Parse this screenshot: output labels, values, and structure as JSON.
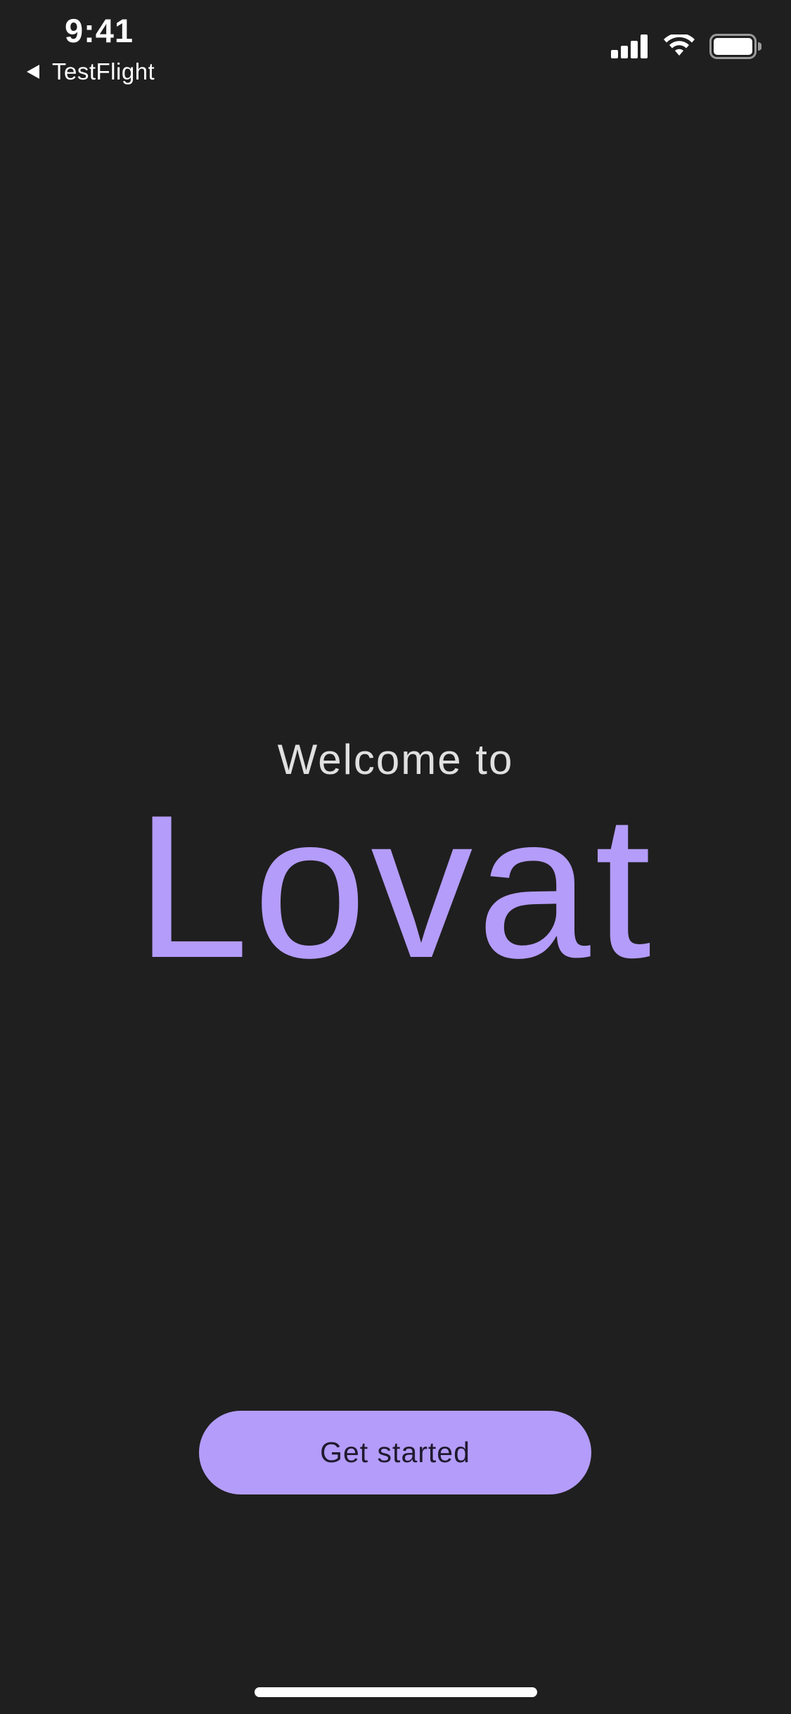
{
  "status_bar": {
    "time": "9:41",
    "back_label": "TestFlight",
    "icons": [
      "cellular-signal-icon",
      "wifi-icon",
      "battery-icon"
    ]
  },
  "welcome": {
    "intro": "Welcome to",
    "app_name": "Lovat"
  },
  "actions": {
    "get_started_label": "Get started"
  },
  "colors": {
    "background": "#1f1f1f",
    "accent": "#b49cfa",
    "text_primary": "#ffffff",
    "text_secondary": "#e0e0e0",
    "button_text": "#1f1a2e"
  }
}
